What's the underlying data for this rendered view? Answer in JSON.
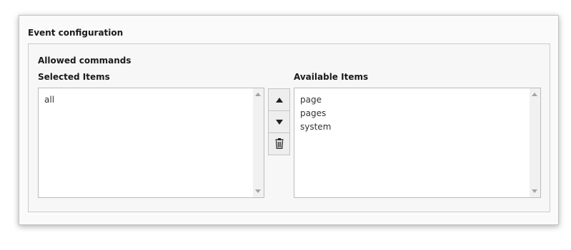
{
  "panel": {
    "title": "Event configuration"
  },
  "fieldset": {
    "label": "Allowed commands",
    "selected": {
      "label": "Selected Items",
      "items": [
        "all"
      ]
    },
    "available": {
      "label": "Available Items",
      "items": [
        "page",
        "pages",
        "system"
      ]
    },
    "buttons": {
      "move_up_icon": "triangle-up",
      "move_down_icon": "triangle-down",
      "remove_icon": "trash"
    }
  }
}
